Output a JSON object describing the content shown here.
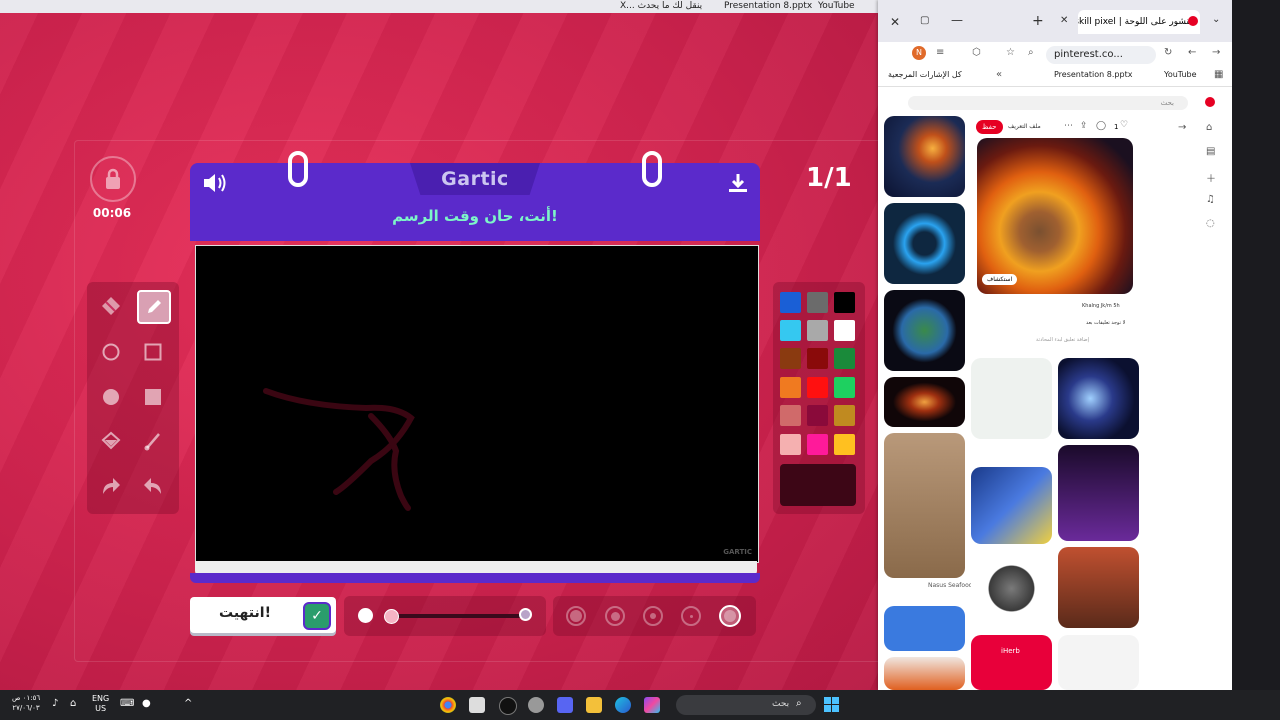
{
  "taskbar_top": {
    "tabs": [
      {
        "label": "YouTube"
      },
      {
        "label": "Presentation 8.pptx"
      },
      {
        "label": "X... ينقل لك ما يحدث"
      }
    ]
  },
  "game": {
    "timer": "00:06",
    "round": "1/1",
    "logo": "Gartic",
    "prompt": "أنت، حان وقت الرسم!",
    "done_label": "انتهيت!",
    "canvas_watermark": "GARTIC",
    "tools": [
      {
        "name": "eraser",
        "icon": "eraser-icon"
      },
      {
        "name": "pencil",
        "icon": "pencil-icon",
        "active": true
      },
      {
        "name": "ellipse-outline",
        "icon": "circle-outline-icon"
      },
      {
        "name": "rect-outline",
        "icon": "square-outline-icon"
      },
      {
        "name": "ellipse-fill",
        "icon": "circle-filled-icon"
      },
      {
        "name": "rect-fill",
        "icon": "square-filled-icon"
      },
      {
        "name": "fill",
        "icon": "bucket-icon"
      },
      {
        "name": "line",
        "icon": "line-icon"
      },
      {
        "name": "redo",
        "icon": "redo-icon"
      },
      {
        "name": "undo",
        "icon": "undo-icon"
      }
    ],
    "palette": [
      "#1a5fd6",
      "#6b6b6b",
      "#000000",
      "#35c8f0",
      "#a9a9a9",
      "#ffffff",
      "#8a3a10",
      "#8a0a0a",
      "#1a8a3a",
      "#f07a20",
      "#ff1010",
      "#1ed060",
      "#d06a6a",
      "#8a0a3a",
      "#c08a20",
      "#f5b0b0",
      "#ff1a9a",
      "#ffc020"
    ],
    "selected_color": "#3d0616"
  },
  "browser": {
    "tab_title": "منشور على اللوحة | skill pixel",
    "url": "pinterest.co...",
    "bookmarks": {
      "all": "كل الإشارات المرجعية",
      "presentation": "Presentation 8.pptx",
      "youtube": "YouTube"
    },
    "pin": {
      "save": "حفظ",
      "profile": "ملف التعريف",
      "like_count": "1",
      "author": "Khalng Jk/m 5h",
      "no_comments": "لا توجد تعليقات بعد",
      "comment_placeholder": "إضافة تعليق لبدء المحادثة",
      "visit": "استكشاف"
    },
    "search_placeholder": "بحث",
    "card_labels": {
      "nasus": "Nasus Seafood",
      "iherb": "iHerb"
    }
  },
  "taskbar": {
    "search": "بحث",
    "lang": "ENG",
    "region": "US",
    "time": "٠١:٥٦ ص",
    "date": "٢٧/٠٦/٠٣"
  }
}
